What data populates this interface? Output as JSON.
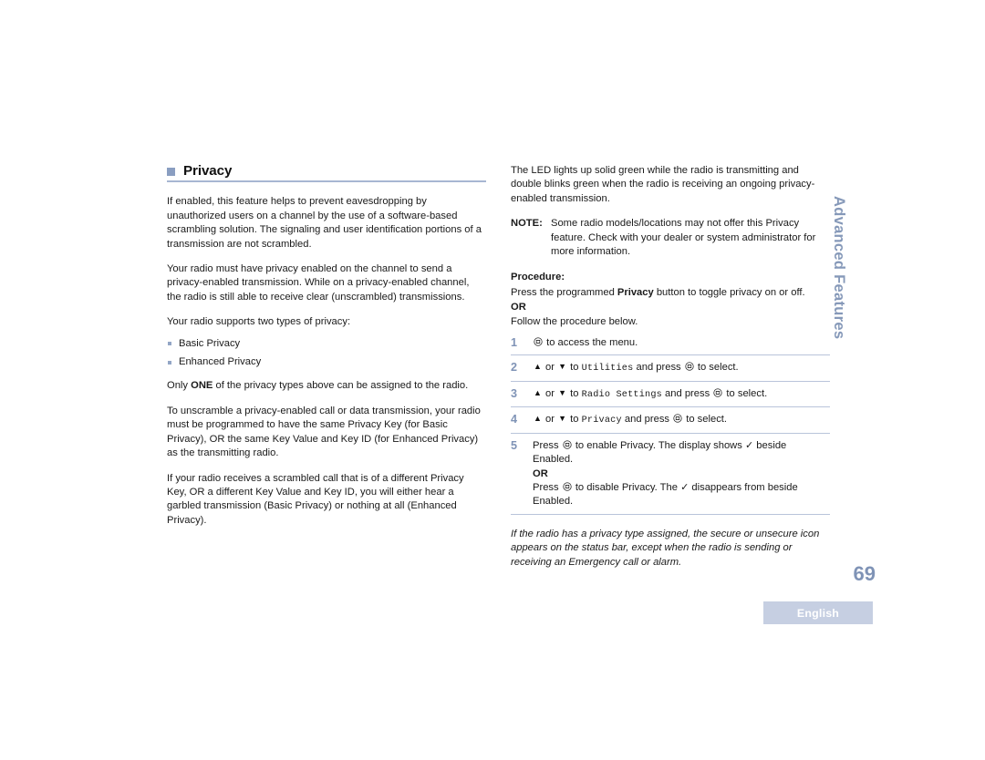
{
  "document": {
    "section_tab": "Advanced Features",
    "page_number": "69",
    "language_badge": "English"
  },
  "left_column": {
    "heading": "Privacy",
    "paragraphs": [
      "If enabled, this feature helps to prevent eavesdropping by unauthorized users on a channel by the use of a software-based scrambling solution. The signaling and user identification portions of a transmission are not scrambled.",
      "Your radio must have privacy enabled on the channel to send a privacy-enabled transmission. While on a privacy-enabled channel, the radio is still able to receive clear (unscrambled) transmissions.",
      "Your radio supports two types of privacy:"
    ],
    "privacy_types": [
      "Basic Privacy",
      "Enhanced Privacy"
    ],
    "only_one_prefix": "Only ",
    "only_one_bold": "ONE",
    "only_one_suffix": " of the privacy types above can be assigned to the radio.",
    "paragraphs_after": [
      "To unscramble a privacy-enabled call or data transmission, your radio must be programmed to have the same Privacy Key (for Basic Privacy), OR the same Key Value and Key ID (for Enhanced Privacy) as the transmitting radio.",
      "If your radio receives a scrambled call that is of a different Privacy Key, OR a different Key Value and Key ID, you will either hear a garbled transmission (Basic Privacy) or nothing at all (Enhanced Privacy)."
    ]
  },
  "right_column": {
    "intro": "The LED lights up solid green while the radio is transmitting and double blinks green when the radio is receiving an ongoing privacy-enabled transmission.",
    "note": {
      "label": "NOTE:",
      "text": "Some radio models/locations may not offer this Privacy feature. Check with your dealer or system administrator for more information."
    },
    "procedure_heading": "Procedure:",
    "procedure_intro_prefix": "Press the programmed ",
    "procedure_intro_bold": "Privacy",
    "procedure_intro_suffix": " button to toggle privacy on or off.",
    "or_label": "OR",
    "follow_below": "Follow the procedure below.",
    "steps": [
      {
        "number": "1",
        "icon": "menu-button-icon",
        "text_after_icon": " to access the menu."
      },
      {
        "number": "2",
        "prefix": " or ",
        "mid": " to ",
        "menu_item": "Utilities",
        "suffix": " and press ",
        "tail": " to select."
      },
      {
        "number": "3",
        "prefix": " or ",
        "mid": " to ",
        "menu_item": "Radio Settings",
        "suffix": " and press ",
        "tail": " to select."
      },
      {
        "number": "4",
        "prefix": " or ",
        "mid": " to ",
        "menu_item": "Privacy",
        "suffix": " and press ",
        "tail": " to select."
      },
      {
        "number": "5",
        "enable_prefix": "Press ",
        "enable_suffix": " to enable Privacy. The display shows ",
        "enable_tail": " beside Enabled.",
        "or_label": "OR",
        "disable_prefix": "Press ",
        "disable_suffix": " to disable Privacy. The ",
        "disable_tail": " disappears from beside Enabled.",
        "check_glyph": "✓"
      }
    ],
    "closing_note": "If the radio has a privacy type assigned, the secure or unsecure icon appears on the status bar, except when the radio is sending or receiving an Emergency call or alarm."
  },
  "colors": {
    "accent_blue_gray": "#8a9ec1",
    "rule": "#a7b6d2",
    "step_number": "#7f93b6",
    "badge_bg": "#c6cfe2",
    "side_tab": "#8699b9"
  }
}
